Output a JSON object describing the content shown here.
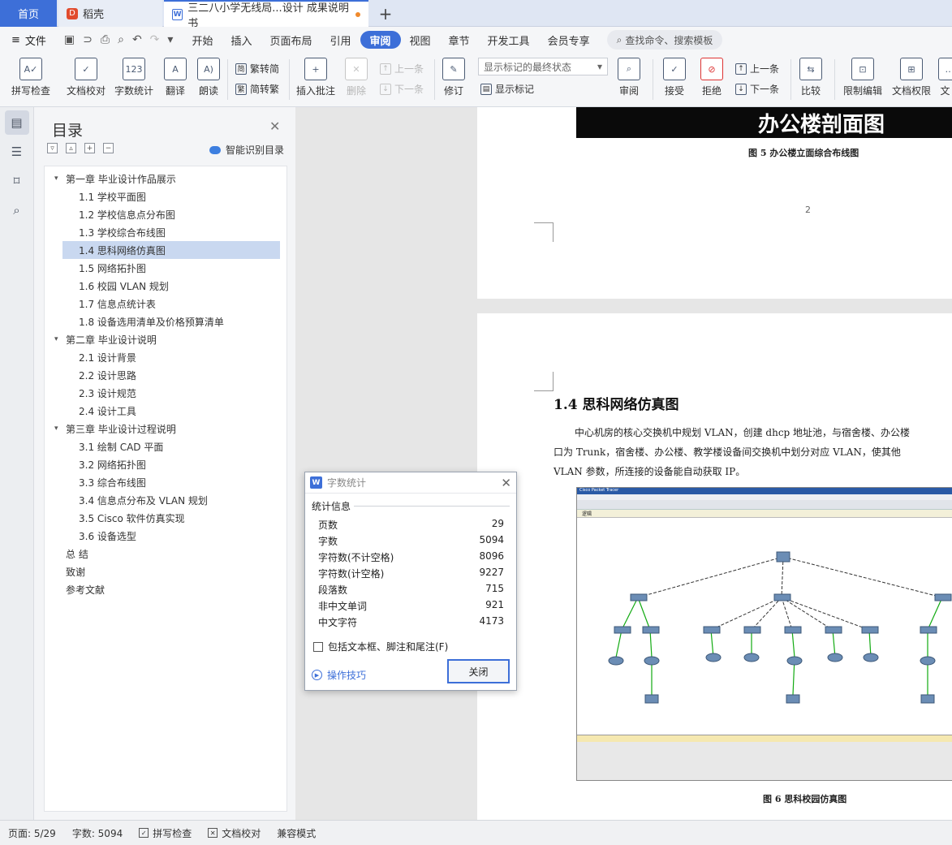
{
  "tabs": {
    "home": "首页",
    "daoke": "稻壳",
    "doc": "三二八小学无线局...设计 成果说明书",
    "add": "+"
  },
  "menu": {
    "file": "文件",
    "items": [
      "开始",
      "插入",
      "页面布局",
      "引用",
      "审阅",
      "视图",
      "章节",
      "开发工具",
      "会员专享"
    ],
    "active": "审阅",
    "search": "查找命令、搜索模板"
  },
  "ribbon": {
    "spell": "拼写检查",
    "proof": "文档校对",
    "wordcount": "字数统计",
    "translate": "翻译",
    "read": "朗读",
    "t2s": "繁转简",
    "s2t": "简转繁",
    "insert_comment": "插入批注",
    "delete": "删除",
    "prev": "上一条",
    "next": "下一条",
    "revise": "修订",
    "markup_select": "显示标记的最终状态",
    "show_markup": "显示标记",
    "review": "审阅",
    "accept": "接受",
    "reject": "拒绝",
    "prev2": "上一条",
    "next2": "下一条",
    "compare": "比较",
    "restrict": "限制编辑",
    "perm": "文档权限",
    "more": "文"
  },
  "toc": {
    "title": "目录",
    "smart": "智能识别目录",
    "items": [
      {
        "text": "第一章  毕业设计作品展示",
        "level": 1
      },
      {
        "text": "1.1  学校平面图",
        "level": 2
      },
      {
        "text": "1.2  学校信息点分布图",
        "level": 2
      },
      {
        "text": "1.3  学校综合布线图",
        "level": 2
      },
      {
        "text": "1.4  思科网络仿真图",
        "level": 2
      },
      {
        "text": "1.5  网络拓扑图",
        "level": 2
      },
      {
        "text": "1.6  校园 VLAN 规划",
        "level": 2
      },
      {
        "text": "1.7  信息点统计表",
        "level": 2
      },
      {
        "text": "1.8  设备选用清单及价格预算清单",
        "level": 2
      },
      {
        "text": "第二章  毕业设计说明",
        "level": 1
      },
      {
        "text": "2.1  设计背景",
        "level": 2
      },
      {
        "text": "2.2  设计思路",
        "level": 2
      },
      {
        "text": "2.3  设计规范",
        "level": 2
      },
      {
        "text": "2.4  设计工具",
        "level": 2
      },
      {
        "text": "第三章  毕业设计过程说明",
        "level": 1
      },
      {
        "text": "3.1  绘制 CAD 平面",
        "level": 2
      },
      {
        "text": "3.2  网络拓扑图",
        "level": 2
      },
      {
        "text": "3.3  综合布线图",
        "level": 2
      },
      {
        "text": "3.4  信息点分布及 VLAN 规划",
        "level": 2
      },
      {
        "text": "3.5 Cisco 软件仿真实现",
        "level": 2
      },
      {
        "text": "3.6  设备选型",
        "level": 2
      },
      {
        "text": "总 结",
        "level": 0
      },
      {
        "text": "致谢",
        "level": 0
      },
      {
        "text": "参考文献",
        "level": 0
      }
    ],
    "selected_index": 4
  },
  "doc": {
    "page1_image_text": "办公楼剖面图",
    "fig5_caption": "图 5  办公楼立面综合布线图",
    "page_number": "2",
    "heading": "1.4  思科网络仿真图",
    "para_line1": "中心机房的核心交换机中规划 VLAN，创建 dhcp 地址池，与宿舍楼、办公楼",
    "para_line2": "口为 Trunk，宿舍楼、办公楼、教学楼设备间交换机中划分对应 VLAN，使其他",
    "para_line3": "VLAN 参数，所连接的设备能自动获取 IP。",
    "sim_title": "Cisco Packet Tracer",
    "sim_tab": "逻辑",
    "fig6_caption": "图 6  思科校园仿真图"
  },
  "dialog": {
    "title": "字数统计",
    "section": "统计信息",
    "rows": [
      {
        "label": "页数",
        "value": "29"
      },
      {
        "label": "字数",
        "value": "5094"
      },
      {
        "label": "字符数(不计空格)",
        "value": "8096"
      },
      {
        "label": "字符数(计空格)",
        "value": "9227"
      },
      {
        "label": "段落数",
        "value": "715"
      },
      {
        "label": "非中文单词",
        "value": "921"
      },
      {
        "label": "中文字符",
        "value": "4173"
      }
    ],
    "checkbox": "包括文本框、脚注和尾注(F)",
    "tips": "操作技巧",
    "close": "关闭"
  },
  "status": {
    "page": "页面: 5/29",
    "words": "字数: 5094",
    "spell": "拼写检查",
    "proof": "文档校对",
    "compat": "兼容模式"
  },
  "colors": {
    "accent": "#3d6fd8",
    "toc_selected": "#c9d8f0"
  }
}
